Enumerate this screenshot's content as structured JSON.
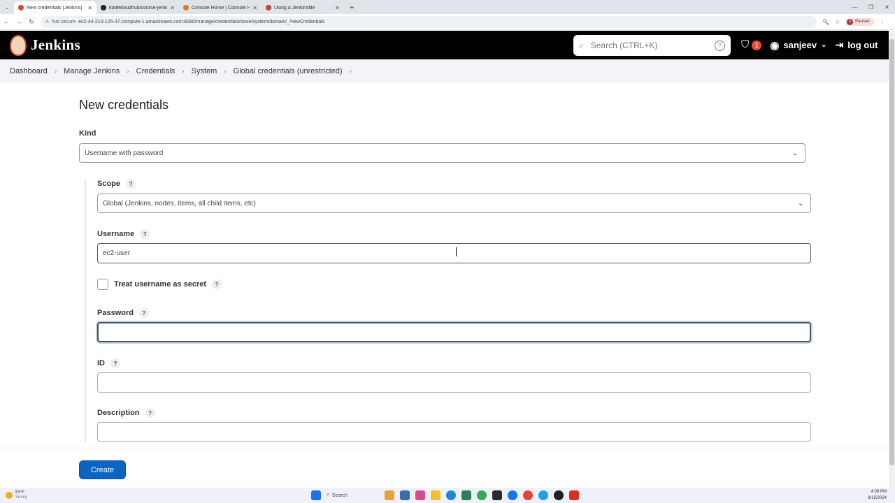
{
  "browser": {
    "tabs": [
      {
        "title": "New credentials [Jenkins]",
        "active": true,
        "favicon_color": "#d24939"
      },
      {
        "title": "kodekloudhub/course-jenkin...",
        "active": false,
        "favicon_color": "#222222"
      },
      {
        "title": "Console Home | Console Home",
        "active": false,
        "favicon_color": "#e07a1f"
      },
      {
        "title": "Using a Jenkinsfile",
        "active": false,
        "favicon_color": "#c8403a"
      }
    ],
    "not_secure": "Not secure",
    "url": "ec2-44-210-125-37.compute-1.amazonaws.com:8080/manage/credentials/store/system/domain/_/newCredentials",
    "profile_status": "Paused",
    "profile_initial": "S"
  },
  "header": {
    "app_name": "Jenkins",
    "search_placeholder": "Search (CTRL+K)",
    "security_count": "1",
    "username": "sanjeev",
    "logout_label": "log out"
  },
  "breadcrumbs": [
    "Dashboard",
    "Manage Jenkins",
    "Credentials",
    "System",
    "Global credentials (unrestricted)"
  ],
  "form": {
    "title": "New credentials",
    "kind_label": "Kind",
    "kind_value": "Username with password",
    "scope_label": "Scope",
    "scope_value": "Global (Jenkins, nodes, items, all child items, etc)",
    "username_label": "Username",
    "username_value": "ec2-user",
    "treat_secret_label": "Treat username as secret",
    "password_label": "Password",
    "password_value": "",
    "id_label": "ID",
    "id_value": "",
    "description_label": "Description",
    "description_value": "",
    "help_glyph": "?",
    "create_label": "Create"
  },
  "taskbar": {
    "weather_temp": "83°F",
    "weather_desc": "Sunny",
    "search_label": "Search",
    "time": "4:09 PM",
    "date": "8/15/2024",
    "app_colors": [
      "#e8a23a",
      "#3a6ea5",
      "#d64b8a",
      "#f2c12e",
      "#1c87d4",
      "#2e7d5b",
      "#34a853",
      "#2b2b2b",
      "#1a73e8",
      "#e0453a",
      "#1da1f2",
      "#202020",
      "#d93025"
    ]
  }
}
